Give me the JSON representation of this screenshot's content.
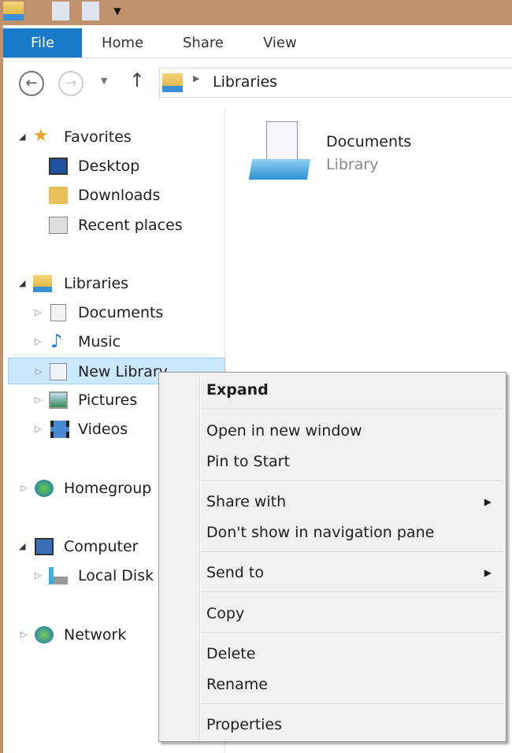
{
  "ribbon": {
    "tabs": [
      "File",
      "Home",
      "Share",
      "View"
    ]
  },
  "address": {
    "path": "Libraries"
  },
  "nav": {
    "favorites": {
      "label": "Favorites",
      "items": [
        "Desktop",
        "Downloads",
        "Recent places"
      ]
    },
    "libraries": {
      "label": "Libraries",
      "items": [
        "Documents",
        "Music",
        "New Library",
        "Pictures",
        "Videos"
      ]
    },
    "homegroup": "Homegroup",
    "computer": {
      "label": "Computer",
      "items": [
        "Local Disk (C:)"
      ]
    },
    "network": "Network"
  },
  "content": {
    "items": [
      {
        "name": "Documents",
        "type": "Library"
      }
    ]
  },
  "context_menu": {
    "items": [
      "Expand",
      "Open in new window",
      "Pin to Start",
      "Share with",
      "Don't show in navigation pane",
      "Send to",
      "Copy",
      "Delete",
      "Rename",
      "Properties"
    ]
  },
  "colors": {
    "accent": "#1979ca",
    "titlebar": "#c0916d",
    "selection": "#cce8ff"
  }
}
